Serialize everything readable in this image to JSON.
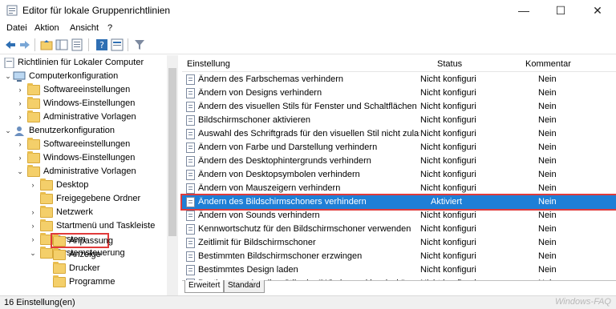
{
  "window": {
    "title": "Editor für lokale Gruppenrichtlinien",
    "min_label": "—",
    "max_label": "☐",
    "close_label": "✕"
  },
  "menu": {
    "items": [
      "Datei",
      "Aktion",
      "Ansicht",
      "?"
    ]
  },
  "tree": {
    "root": "Richtlinien für Lokaler Computer",
    "computer": "Computerkonfiguration",
    "computer_children": [
      "Softwareeinstellungen",
      "Windows-Einstellungen",
      "Administrative Vorlagen"
    ],
    "user": "Benutzerkonfiguration",
    "user_children": [
      "Softwareeinstellungen",
      "Windows-Einstellungen",
      "Administrative Vorlagen"
    ],
    "admin_children": [
      "Desktop",
      "Freigegebene Ordner",
      "Netzwerk",
      "Startmenü und Taskleiste",
      "System",
      "Systemsteuerung"
    ],
    "systemsteuerung_children": [
      "Anpassung",
      "Anzeige",
      "Drucker",
      "Programme"
    ]
  },
  "list": {
    "headers": {
      "setting": "Einstellung",
      "status": "Status",
      "comment": "Kommentar"
    },
    "rows": [
      {
        "name": "Ändern des Farbschemas verhindern",
        "status": "Nicht konfiguri",
        "comment": "Nein"
      },
      {
        "name": "Ändern von Designs verhindern",
        "status": "Nicht konfiguri",
        "comment": "Nein"
      },
      {
        "name": "Ändern des visuellen Stils für Fenster und Schaltflächen verhi...",
        "status": "Nicht konfiguri",
        "comment": "Nein"
      },
      {
        "name": "Bildschirmschoner aktivieren",
        "status": "Nicht konfiguri",
        "comment": "Nein"
      },
      {
        "name": "Auswahl des Schriftgrads für den visuellen Stil nicht zulassen",
        "status": "Nicht konfiguri",
        "comment": "Nein"
      },
      {
        "name": "Ändern von Farbe und Darstellung verhindern",
        "status": "Nicht konfiguri",
        "comment": "Nein"
      },
      {
        "name": "Ändern des Desktophintergrunds verhindern",
        "status": "Nicht konfiguri",
        "comment": "Nein"
      },
      {
        "name": "Ändern von Desktopsymbolen verhindern",
        "status": "Nicht konfiguri",
        "comment": "Nein"
      },
      {
        "name": "Ändern von Mauszeigern verhindern",
        "status": "Nicht konfiguri",
        "comment": "Nein"
      },
      {
        "name": "Ändern des Bildschirmschoners verhindern",
        "status": "Aktiviert",
        "comment": "Nein"
      },
      {
        "name": "Ändern von Sounds verhindern",
        "status": "Nicht konfiguri",
        "comment": "Nein"
      },
      {
        "name": "Kennwortschutz für den Bildschirmschoner verwenden",
        "status": "Nicht konfiguri",
        "comment": "Nein"
      },
      {
        "name": "Zeitlimit für Bildschirmschoner",
        "status": "Nicht konfiguri",
        "comment": "Nein"
      },
      {
        "name": "Bestimmten Bildschirmschoner erzwingen",
        "status": "Nicht konfiguri",
        "comment": "Nein"
      },
      {
        "name": "Bestimmtes Design laden",
        "status": "Nicht konfiguri",
        "comment": "Nein"
      },
      {
        "name": "Bestimmten visuellen Stil oder \"Windows - klassisch\" erzwing",
        "status": "Nicht konfiguri",
        "comment": "Nein"
      }
    ]
  },
  "tabs": {
    "extended": "Erweitert",
    "standard": "Standard"
  },
  "status": {
    "text": "16 Einstellung(en)"
  },
  "watermark": "Windows-FAQ",
  "colors": {
    "selection": "#1f7fd6",
    "highlight_border": "#e03a3a",
    "folder": "#f4cf6a"
  }
}
